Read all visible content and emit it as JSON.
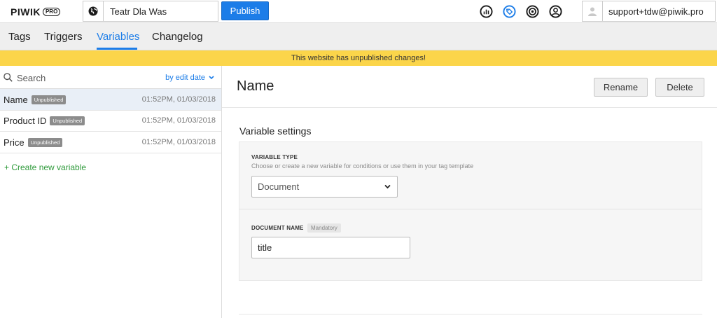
{
  "header": {
    "logo_text": "PIWIK",
    "logo_badge": "PRO",
    "site_name": "Teatr Dla Was",
    "publish_label": "Publish",
    "icons": [
      "stats-icon",
      "tag-icon",
      "target-icon",
      "user-circle-icon"
    ],
    "user_email": "support+tdw@piwik.pro"
  },
  "nav": {
    "tabs": [
      {
        "label": "Tags"
      },
      {
        "label": "Triggers"
      },
      {
        "label": "Variables",
        "active": true
      },
      {
        "label": "Changelog"
      }
    ]
  },
  "banner": {
    "text": "This website has unpublished changes!"
  },
  "sidebar": {
    "search_placeholder": "Search",
    "sort_label": "by edit date",
    "variables": [
      {
        "name": "Name",
        "status": "Unpublished",
        "date": "01:52PM, 01/03/2018",
        "selected": true
      },
      {
        "name": "Product ID",
        "status": "Unpublished",
        "date": "01:52PM, 01/03/2018"
      },
      {
        "name": "Price",
        "status": "Unpublished",
        "date": "01:52PM, 01/03/2018"
      }
    ],
    "create_label": "+ Create new variable"
  },
  "main": {
    "title": "Name",
    "rename_label": "Rename",
    "delete_label": "Delete",
    "section_title": "Variable settings",
    "variable_type": {
      "label": "VARIABLE TYPE",
      "description": "Choose or create a new variable for conditions or use them in your tag template",
      "value": "Document"
    },
    "document_name": {
      "label": "DOCUMENT NAME",
      "badge": "Mandatory",
      "value": "title"
    }
  },
  "colors": {
    "accent": "#1c7de8",
    "banner": "#fbd54a",
    "create_link": "#2e9a3a",
    "badge": "#8c8c8c"
  }
}
